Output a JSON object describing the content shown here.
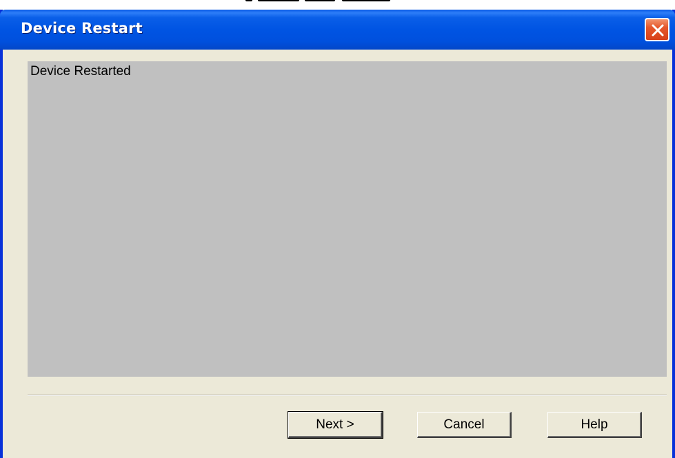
{
  "window": {
    "title": "Device Restart"
  },
  "content": {
    "message": "Device Restarted"
  },
  "buttons": {
    "next_label": "Next >",
    "cancel_label": "Cancel",
    "help_label": "Help"
  },
  "icons": {
    "close": "close-icon"
  },
  "colors": {
    "titlebar": "#0054e3",
    "window_bg": "#ece9d8",
    "panel_bg": "#c0c0c0",
    "close_btn": "#e5572c"
  }
}
